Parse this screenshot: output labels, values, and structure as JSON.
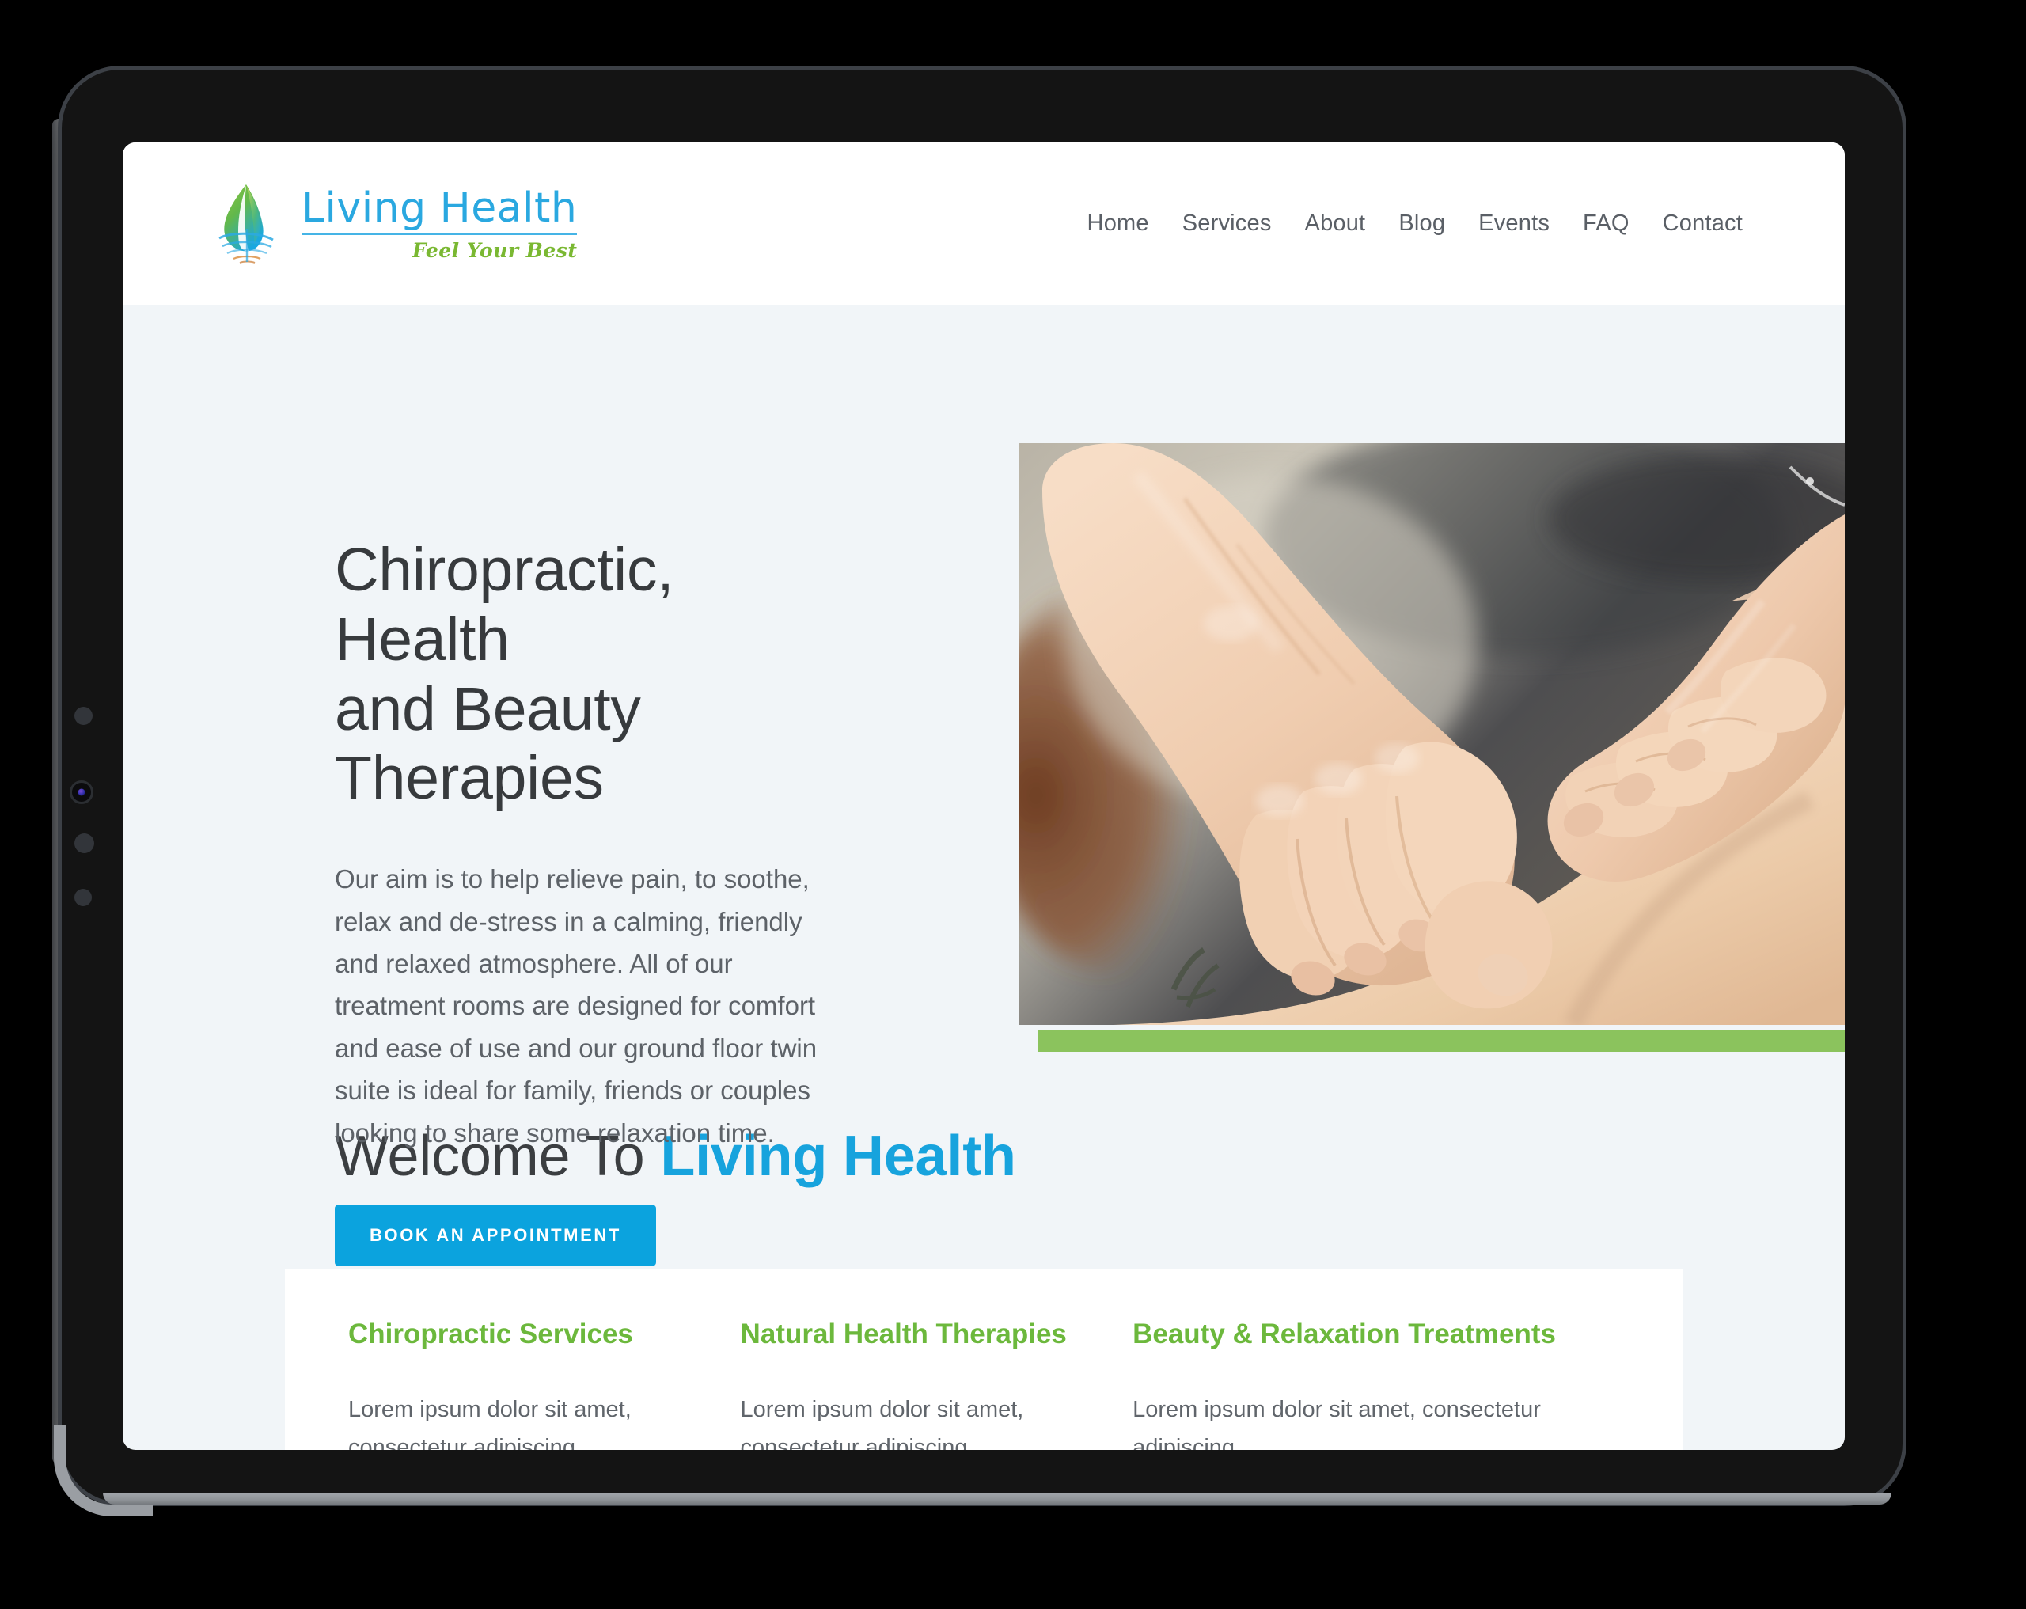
{
  "brand": {
    "name": "Living Health",
    "tagline": "Feel Your Best",
    "logo_icon": "leaf-water-drop-ripple-icon"
  },
  "nav": {
    "items": [
      {
        "label": "Home"
      },
      {
        "label": "Services"
      },
      {
        "label": "About"
      },
      {
        "label": "Blog"
      },
      {
        "label": "Events"
      },
      {
        "label": "FAQ"
      },
      {
        "label": "Contact"
      }
    ]
  },
  "hero": {
    "title": "Chiropractic, Health and Beauty Therapies",
    "title_line1": "Chiropractic, Health",
    "title_line2": "and Beauty Therapies",
    "paragraph": "Our aim is to help relieve pain, to soothe, relax and de-stress in a calming, friendly and relaxed atmosphere. All of our treatment rooms are designed for comfort and ease of use and our ground floor twin suite is ideal for family, friends or couples looking to share some relaxation time.",
    "cta_label": "BOOK AN APPOINTMENT",
    "image_alt": "massage-therapy-hands-on-back-photo"
  },
  "welcome": {
    "prefix": "Welcome To ",
    "accent": "Living Health"
  },
  "services": [
    {
      "title": "Chiropractic Services",
      "text": "Lorem ipsum dolor sit amet, consectetur adipiscing"
    },
    {
      "title": "Natural Health Therapies",
      "text": "Lorem ipsum dolor sit amet, consectetur adipiscing"
    },
    {
      "title": "Beauty & Relaxation Treatments",
      "text": "Lorem ipsum dolor sit amet, consectetur adipiscing"
    }
  ],
  "colors": {
    "brand_blue": "#2aa8e0",
    "accent_blue": "#0ba3de",
    "accent_green": "#8bc35d",
    "service_green": "#6cb83c",
    "page_background": "#f1f5f8",
    "heading_text": "#373a3d",
    "body_text": "#5d6268"
  },
  "device": {
    "type": "tablet-mockup",
    "bezel_color": "#141414",
    "rim_color": "#9a9ea3"
  }
}
